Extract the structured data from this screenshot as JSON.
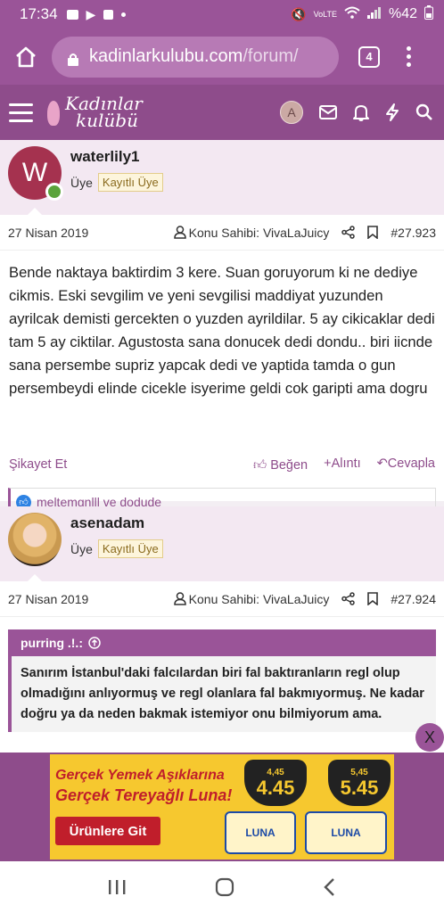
{
  "status_bar": {
    "time": "17:34",
    "battery": "%42"
  },
  "browser": {
    "url_domain": "kadinlarkulubu.com",
    "url_path": "/forum/",
    "tab_count": "4"
  },
  "site": {
    "logo_line1": "Kadınlar",
    "logo_line2": "kulübü",
    "avatar_letter": "A"
  },
  "posts": [
    {
      "avatar_letter": "W",
      "username": "waterlily1",
      "role": "Üye",
      "badge": "Kayıtlı Üye",
      "date": "27 Nisan 2019",
      "owner": "Konu Sahibi: VivaLaJuicy",
      "number": "#27.923",
      "body": "Bende naktaya baktirdim 3 kere. Suan goruyorum ki ne dediye cikmis. Eski sevgilim ve yeni sevgilisi maddiyat yuzunden ayrilcak demisti gercekten o yuzden ayrildilar. 5 ay cikicaklar dedi tam 5 ay ciktilar. Agustosta sana donucek dedi dondu.. biri iicnde sana persembe supriz yapcak dedi ve yaptida tamda o gun persembeydi elinde cicekle isyerime geldi cok garipti ama dogru",
      "report": "Şikayet Et",
      "like": "Beğen",
      "quote": "Alıntı",
      "reply": "Cevapla",
      "likes_text": "meltemgnlll ve dodude"
    },
    {
      "username": "asenadam",
      "role": "Üye",
      "badge": "Kayıtlı Üye",
      "date": "27 Nisan 2019",
      "owner": "Konu Sahibi: VivaLaJuicy",
      "number": "#27.924",
      "quote_author": "purring .!.:",
      "quote_text": "Sanırım İstanbul'daki falcılardan biri fal baktıranların regl olup olmadığını anlıyormuş ve regl olanlara fal bakmıyormuş. Ne kadar doğru ya da neden bakmak istemiyor onu bilmiyorum ama."
    }
  ],
  "ad": {
    "close": "X",
    "headline1": "Gerçek Yemek Aşıklarına",
    "headline2": "Gerçek Tereyağlı Luna!",
    "cta": "Ürünlere Git",
    "price1_top": "4,45",
    "price1": "4.45",
    "price2_top": "5,45",
    "price2": "5.45",
    "brand": "LUNA"
  },
  "colors": {
    "brand": "#9a5498",
    "header": "#8e4c8b",
    "online": "#5ba33b"
  }
}
